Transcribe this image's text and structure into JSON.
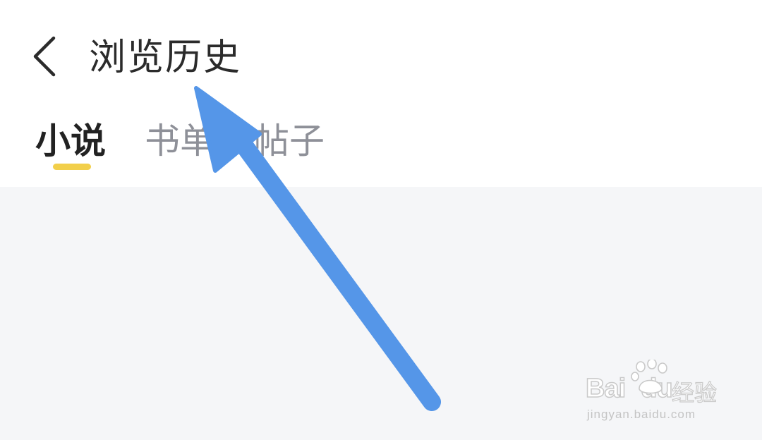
{
  "header": {
    "back_icon": "chevron-left-icon",
    "title": "浏览历史"
  },
  "tabs": [
    {
      "label": "小说",
      "active": true
    },
    {
      "label": "书单",
      "active": false
    },
    {
      "label": "帖子",
      "active": false
    }
  ],
  "overlay": {
    "arrow_color": "#5596e8",
    "arrow_icon": "annotation-arrow-icon"
  },
  "watermark": {
    "logo_prefix": "Bai",
    "logo_mid": "du",
    "logo_suffix": "经验",
    "url": "jingyan.baidu.com"
  },
  "colors": {
    "background": "#ffffff",
    "content_background": "#f5f6f8",
    "active_tab_text": "#222222",
    "inactive_tab_text": "#8e9098",
    "tab_indicator": "#f2cf4a"
  }
}
